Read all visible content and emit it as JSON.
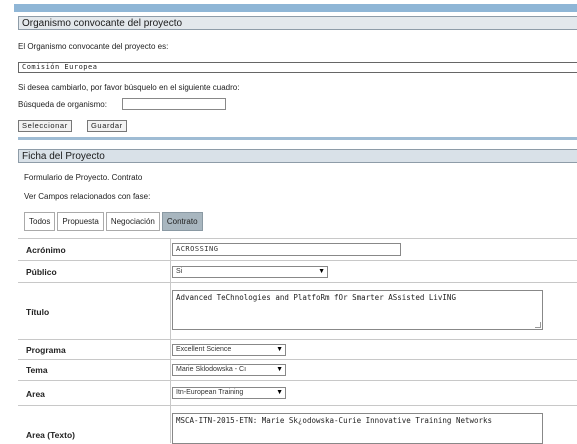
{
  "organismo": {
    "header": "Organismo convocante del proyecto",
    "intro": "El Organismo convocante del proyecto es:",
    "value": "Comisión Europea",
    "change_text": "Si desea cambiarlo, por favor búsquelo en el siguiente cuadro:",
    "search_label": "Búsqueda de organismo:",
    "search_value": "",
    "btn_select": "Seleccionar",
    "btn_save": "Guardar"
  },
  "ficha": {
    "header": "Ficha del Proyecto",
    "form_text": "Formulario de Proyecto. Contrato",
    "fields_text": "Ver Campos relacionados con fase:",
    "tabs": [
      "Todos",
      "Propuesta",
      "Negociación",
      "Contrato"
    ],
    "active_tab": "Contrato",
    "rows": {
      "acronimo": {
        "label": "Acrónimo",
        "value": "ACROSSING"
      },
      "publico": {
        "label": "Público",
        "value": "Si"
      },
      "titulo": {
        "label": "Título",
        "value": "Advanced TeChnologies and PlatfoRm fOr Smarter ASsisted LivING"
      },
      "programa": {
        "label": "Programa",
        "value": "Excellent Science"
      },
      "tema": {
        "label": "Tema",
        "value": "Marie Sklodowska - Cı"
      },
      "area": {
        "label": "Area",
        "value": "Itn-European Training"
      },
      "area_texto": {
        "label": "Area (Texto)",
        "value": "MSCA-ITN-2015-ETN: Marie Sk¿odowska-Curie Innovative Training Networks"
      }
    }
  },
  "colors": {
    "header_bg": "#e3e8ec",
    "separator": "#9fbcd4",
    "active_tab": "#a8b6bf"
  }
}
